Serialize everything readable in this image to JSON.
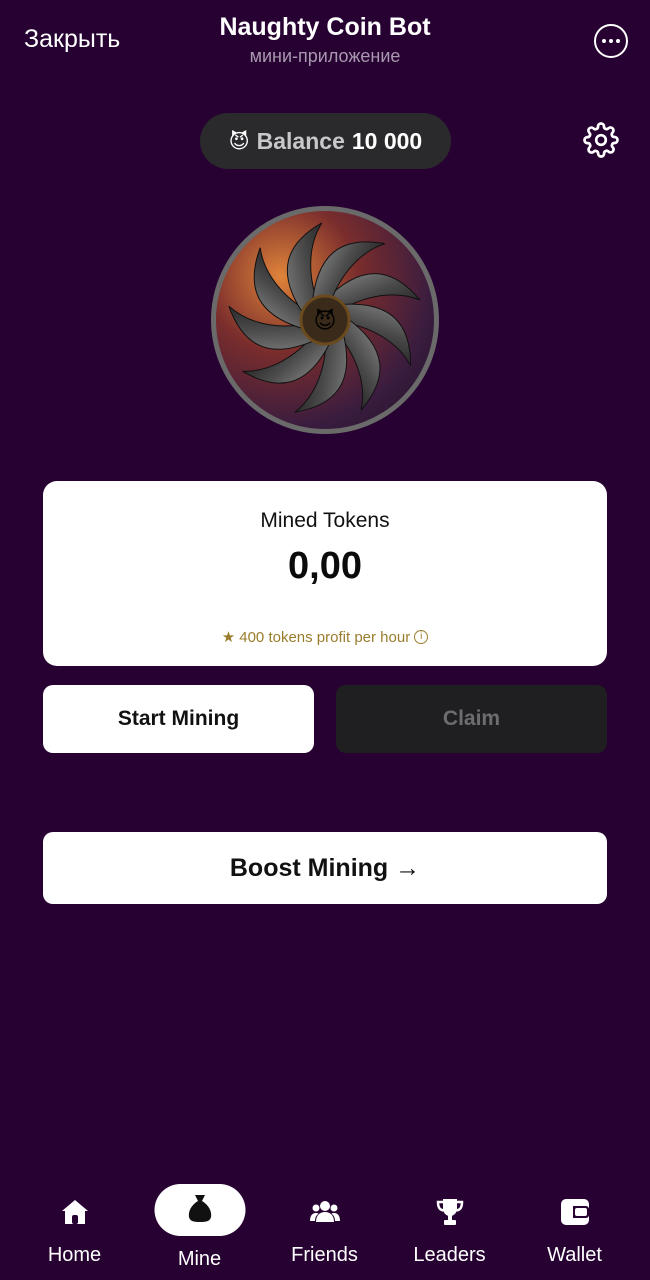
{
  "header": {
    "close_label": "Закрыть",
    "title": "Naughty Coin Bot",
    "subtitle": "мини-приложение",
    "more_icon": "ellipsis-circle-icon"
  },
  "balance": {
    "emoji": "😈",
    "label": "Balance",
    "value": "10 000"
  },
  "settings_icon": "gear-icon",
  "fan": {
    "center_emoji": "😈"
  },
  "mined": {
    "title": "Mined Tokens",
    "value": "0,00",
    "profit_text": "400 tokens profit per hour",
    "profit_icon": "star-icon",
    "info_symbol": "i"
  },
  "buttons": {
    "start": "Start Mining",
    "claim": "Claim",
    "boost": "Boost Mining →"
  },
  "nav": {
    "items": [
      {
        "label": "Home",
        "icon": "home-icon"
      },
      {
        "label": "Mine",
        "icon": "money-bag-icon",
        "active": true
      },
      {
        "label": "Friends",
        "icon": "friends-icon"
      },
      {
        "label": "Leaders",
        "icon": "trophy-icon"
      },
      {
        "label": "Wallet",
        "icon": "wallet-icon"
      }
    ]
  },
  "colors": {
    "background": "#260131",
    "card": "#ffffff",
    "pill": "#2a2a2c",
    "claim_bg": "#1f1f21",
    "profit_text": "#9a7d2c"
  }
}
